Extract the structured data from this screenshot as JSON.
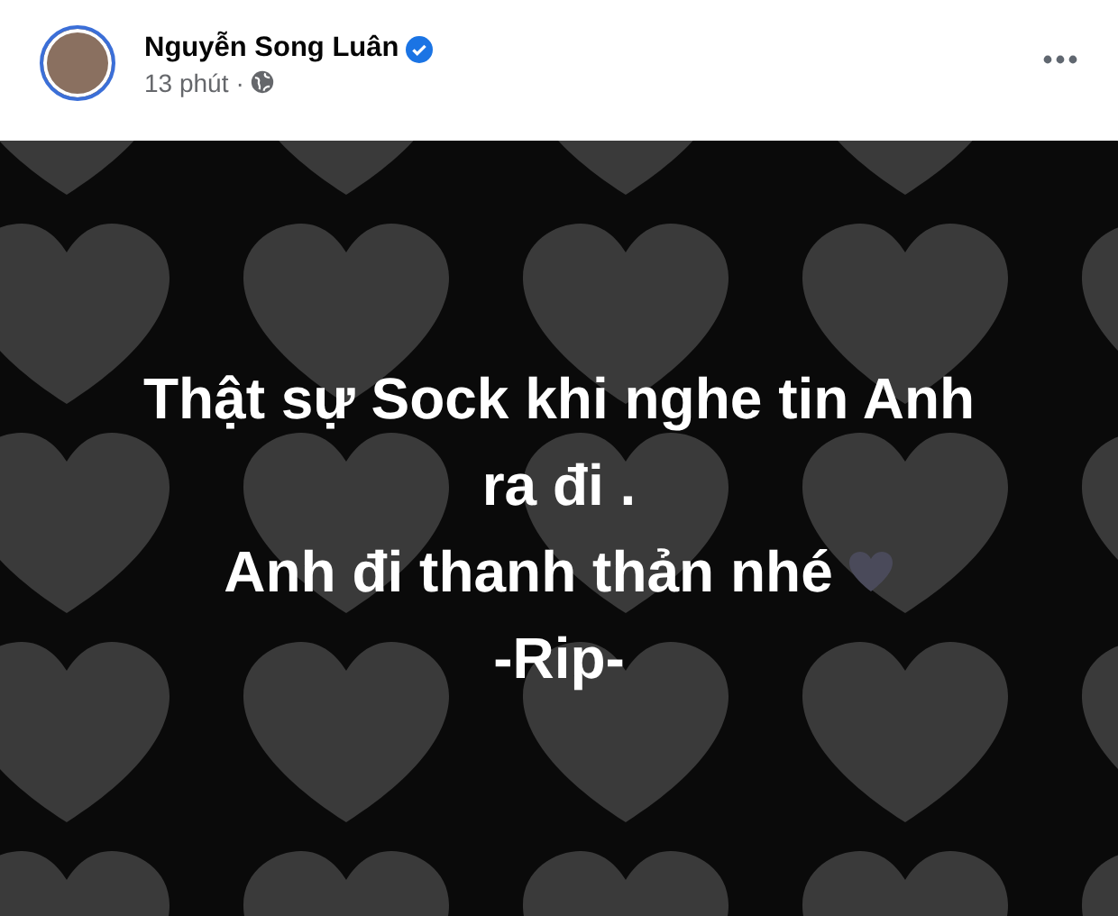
{
  "post": {
    "author": "Nguyễn Song Luân",
    "verified": true,
    "time": "13 phút",
    "separator": "·",
    "image_text": [
      {
        "text": "Thật sự Sock khi nghe tin Anh",
        "kind": "plain"
      },
      {
        "text": "ra đi .",
        "kind": "plain"
      },
      {
        "text": "Anh đi thanh thản nhé",
        "kind": "heart"
      },
      {
        "text": "-Rip-",
        "kind": "plain"
      }
    ]
  }
}
